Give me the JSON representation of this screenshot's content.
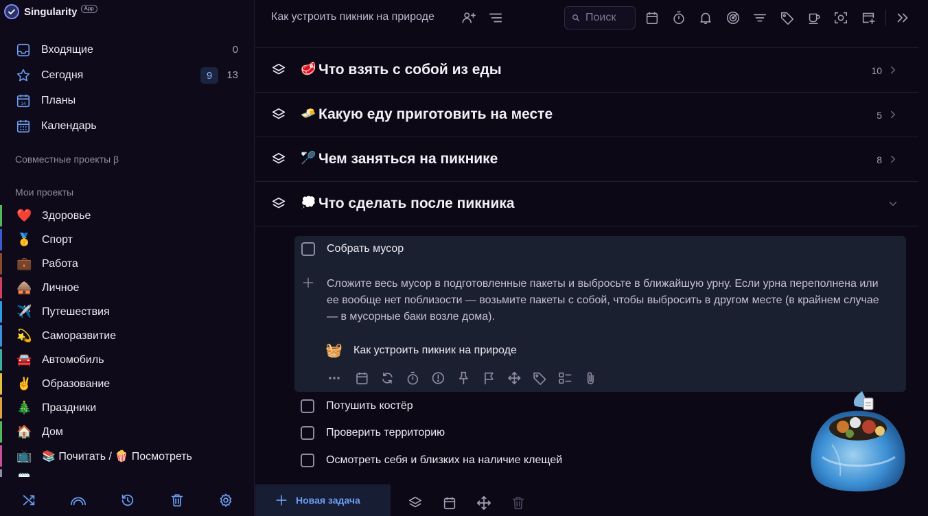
{
  "app": {
    "name": "Singularity",
    "badge": "App"
  },
  "sidebar": {
    "nav": [
      {
        "label": "Входящие",
        "icon": "inbox-icon",
        "count": "0"
      },
      {
        "label": "Сегодня",
        "icon": "star-icon",
        "count_today": "9",
        "count": "13"
      },
      {
        "label": "Планы",
        "icon": "calendar-14-icon"
      },
      {
        "label": "Календарь",
        "icon": "calendar-grid-icon"
      }
    ],
    "shared_projects_title": "Совместные проекты β",
    "my_projects_title": "Мои проекты",
    "projects": [
      {
        "label": "Здоровье",
        "emoji": "❤️",
        "color": "#4fb85c"
      },
      {
        "label": "Спорт",
        "emoji": "🥇",
        "color": "#3b5ad0"
      },
      {
        "label": "Работа",
        "emoji": "💼",
        "color": "#8a4b2d"
      },
      {
        "label": "Личное",
        "emoji": "🛖",
        "color": "#d23d62"
      },
      {
        "label": "Путешествия",
        "emoji": "✈️",
        "color": "#2b9de0"
      },
      {
        "label": "Саморазвитие",
        "emoji": "💫",
        "color": "#3e8fe0"
      },
      {
        "label": "Автомобиль",
        "emoji": "🚘",
        "color": "#3ab0a0"
      },
      {
        "label": "Образование",
        "emoji": "✌️",
        "color": "#e2c23a"
      },
      {
        "label": "Праздники",
        "emoji": "🎄",
        "color": "#e0a23a"
      },
      {
        "label": "Дом",
        "emoji": "🏠",
        "color": "#4fb85c"
      },
      {
        "label": "📚 Почитать / 🍿 Посмотреть",
        "emoji": "📺",
        "color": "#c84f9a"
      }
    ],
    "footer_icons": [
      "shuffle-icon",
      "rainbow-icon",
      "history-icon",
      "trash-icon",
      "settings-icon"
    ]
  },
  "header": {
    "title": "Как устроить пикник на природе",
    "search_placeholder": "Поиск",
    "icons": [
      "add-user-icon",
      "sort-icon",
      "calendar-icon",
      "timer-icon",
      "bell-icon",
      "focus-icon",
      "filter-icon",
      "tag-icon",
      "coffee-icon",
      "scan-icon",
      "window-add-icon",
      "collapse-right-icon"
    ]
  },
  "groups": [
    {
      "emoji": "🥩",
      "title": "Что взять с собой из еды",
      "count": "10",
      "expanded": false
    },
    {
      "emoji": "🧈",
      "title": "Какую еду приготовить на месте",
      "count": "5",
      "expanded": false
    },
    {
      "emoji": "🏸",
      "title": "Чем заняться на пикнике",
      "count": "8",
      "expanded": false
    },
    {
      "emoji": "💭",
      "title": "Что сделать после пикника",
      "count": "",
      "expanded": true
    }
  ],
  "selected_task": {
    "title": "Собрать мусор",
    "description": "Сложите весь мусор в подготовленные пакеты и выбросьте в ближайшую урну. Если урна переполнена или ее вообще нет поблизости — возьмите пакеты с собой, чтобы выбросить в другом месте (в крайнем случае — в мусорные баки возле дома).",
    "project_emoji": "🧺",
    "project_label": "Как устроить пикник на природе",
    "tools": [
      "more-icon",
      "calendar-icon",
      "repeat-icon",
      "timer-icon",
      "priority-icon",
      "pin-icon",
      "flag-icon",
      "move-icon",
      "tag-icon",
      "checklist-icon",
      "attachment-icon"
    ]
  },
  "tasks": [
    {
      "title": "Потушить костёр"
    },
    {
      "title": "Проверить территорию"
    },
    {
      "title": "Осмотреть себя и близких на наличие клещей"
    }
  ],
  "bottom_bar": {
    "new_task_label": "Новая задача",
    "icons": [
      "layers-icon",
      "calendar-icon",
      "move-icon",
      "trash-icon"
    ]
  }
}
